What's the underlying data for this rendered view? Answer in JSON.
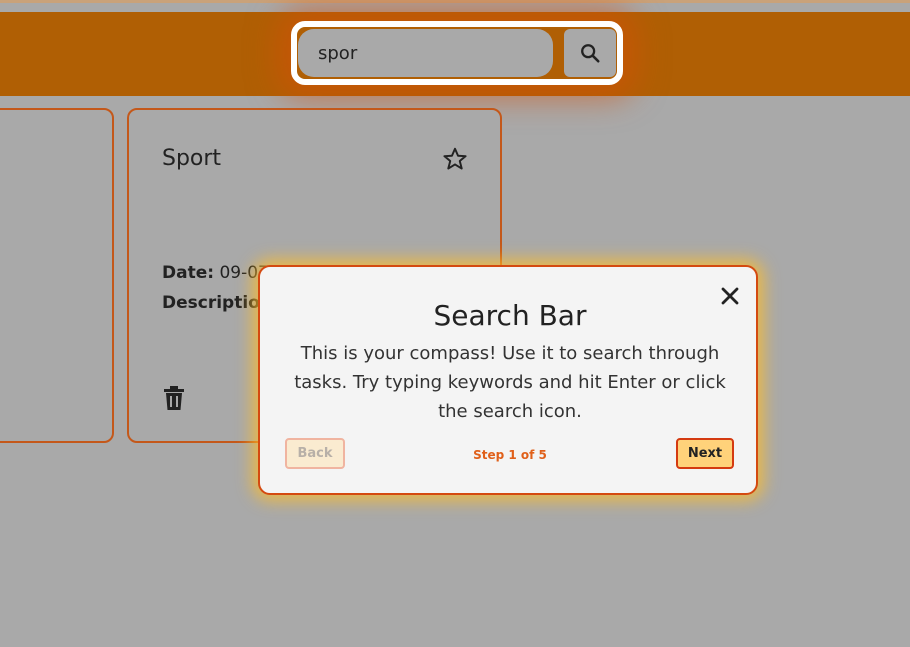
{
  "header": {
    "search": {
      "value": "spor",
      "button_icon": "search-icon"
    }
  },
  "cards": [
    {
      "title": "Sport",
      "star_icon": "star-outline-icon",
      "date_label": "Date:",
      "date_value": "09-07-2025",
      "description_label": "Description",
      "delete_icon": "trash-icon"
    }
  ],
  "tour": {
    "title": "Search Bar",
    "text": "This is your compass! Use it to search through tasks. Try typing keywords and hit Enter or click the search icon.",
    "back_label": "Back",
    "next_label": "Next",
    "step_text": "Step 1 of 5",
    "close_icon": "close-icon"
  },
  "colors": {
    "header": "#b05f04",
    "card_border": "#c4581a",
    "dialog_border": "#d44a10",
    "next_button": "#ffd27a",
    "step_text": "#e0601a"
  }
}
